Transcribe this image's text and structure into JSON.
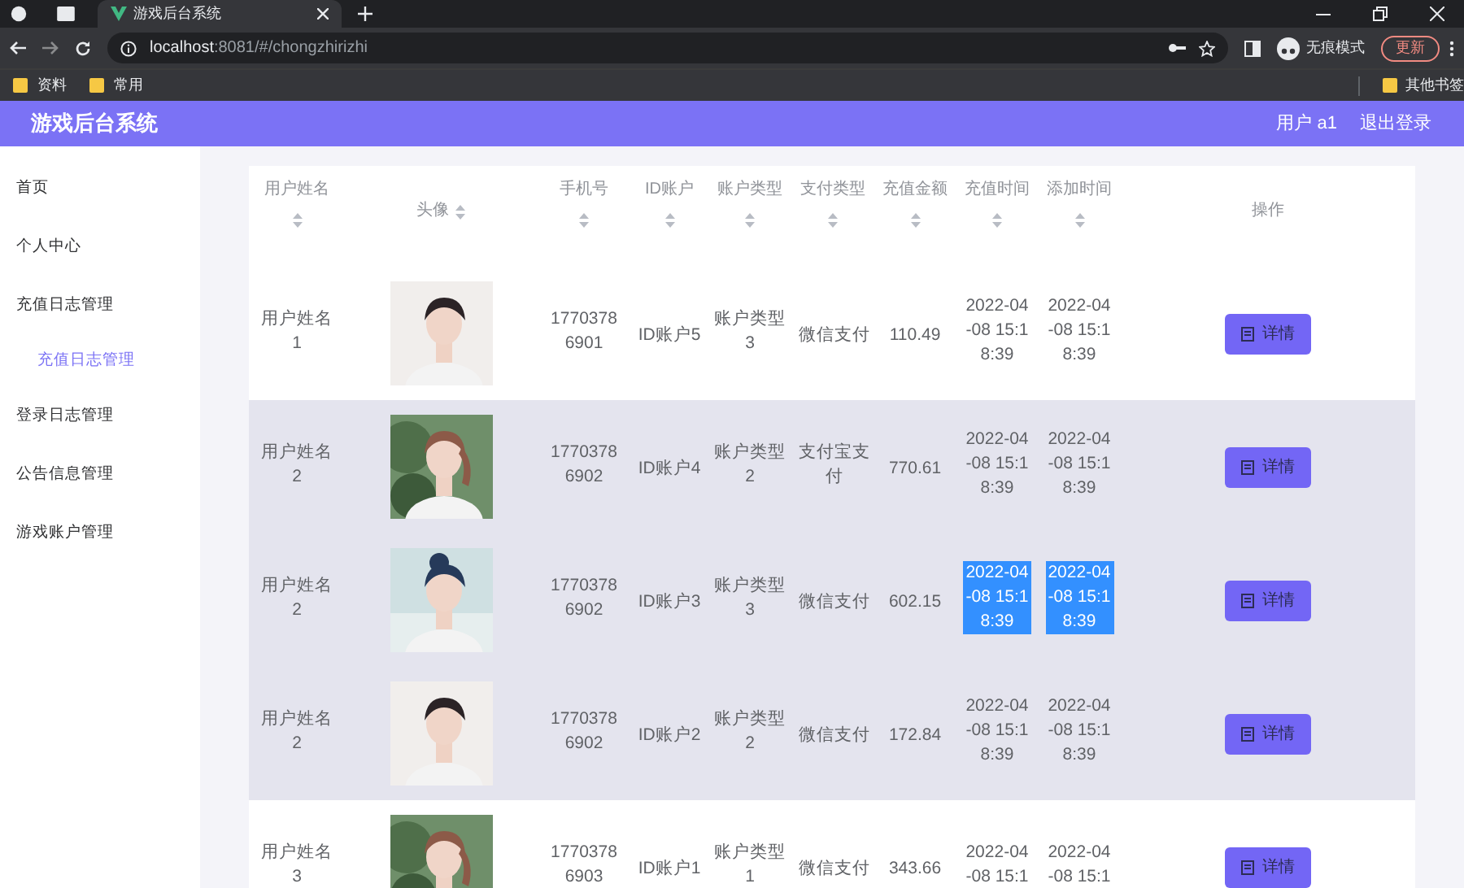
{
  "browser": {
    "tab_title": "游戏后台系统",
    "url_host": "localhost",
    "url_rest": ":8081/#/chongzhirizhi",
    "incognito_label": "无痕模式",
    "update_button": "更新",
    "bookmarks": [
      "资料",
      "常用"
    ],
    "other_bookmarks": "其他书签"
  },
  "header": {
    "title": "游戏后台系统",
    "user": "用户 a1",
    "logout": "退出登录"
  },
  "sidebar": {
    "items": [
      {
        "label": "首页",
        "selected": false
      },
      {
        "label": "个人中心",
        "selected": false
      },
      {
        "label": "充值日志管理",
        "selected": false,
        "children": [
          {
            "label": "充值日志管理",
            "selected": true
          }
        ]
      },
      {
        "label": "登录日志管理",
        "selected": false
      },
      {
        "label": "公告信息管理",
        "selected": false
      },
      {
        "label": "游戏账户管理",
        "selected": false
      }
    ]
  },
  "table": {
    "columns": [
      {
        "label": "用户姓名",
        "sortable": true
      },
      {
        "label": "头像",
        "sortable": true
      },
      {
        "label": "手机号",
        "sortable": true
      },
      {
        "label": "ID账户",
        "sortable": true
      },
      {
        "label": "账户类型",
        "sortable": true
      },
      {
        "label": "支付类型",
        "sortable": true
      },
      {
        "label": "充值金额",
        "sortable": true
      },
      {
        "label": "充值时间",
        "sortable": true
      },
      {
        "label": "添加时间",
        "sortable": true
      },
      {
        "label": "操作",
        "sortable": false
      }
    ],
    "rows": [
      {
        "name": "用户姓名1",
        "phone": "17703786901",
        "account": "ID账户5",
        "account_type": "账户类型3",
        "pay_type": "微信支付",
        "amount": "110.49",
        "charge_time": "2022-04-08 15:18:39",
        "add_time": "2022-04-08 15:18:39",
        "shaded": false,
        "times_highlighted": false,
        "action": "详情"
      },
      {
        "name": "用户姓名2",
        "phone": "17703786902",
        "account": "ID账户4",
        "account_type": "账户类型2",
        "pay_type": "支付宝支付",
        "amount": "770.61",
        "charge_time": "2022-04-08 15:18:39",
        "add_time": "2022-04-08 15:18:39",
        "shaded": true,
        "times_highlighted": false,
        "action": "详情"
      },
      {
        "name": "用户姓名2",
        "phone": "17703786902",
        "account": "ID账户3",
        "account_type": "账户类型3",
        "pay_type": "微信支付",
        "amount": "602.15",
        "charge_time": "2022-04-08 15:18:39",
        "add_time": "2022-04-08 15:18:39",
        "shaded": true,
        "times_highlighted": true,
        "action": "详情"
      },
      {
        "name": "用户姓名2",
        "phone": "17703786902",
        "account": "ID账户2",
        "account_type": "账户类型2",
        "pay_type": "微信支付",
        "amount": "172.84",
        "charge_time": "2022-04-08 15:18:39",
        "add_time": "2022-04-08 15:18:39",
        "shaded": true,
        "times_highlighted": false,
        "action": "详情"
      },
      {
        "name": "用户姓名3",
        "phone": "17703786903",
        "account": "ID账户1",
        "account_type": "账户类型1",
        "pay_type": "微信支付",
        "amount": "343.66",
        "charge_time": "2022-04-08 15:1",
        "add_time": "2022-04-08 15:1",
        "shaded": false,
        "times_highlighted": false,
        "action": "详情"
      }
    ]
  }
}
